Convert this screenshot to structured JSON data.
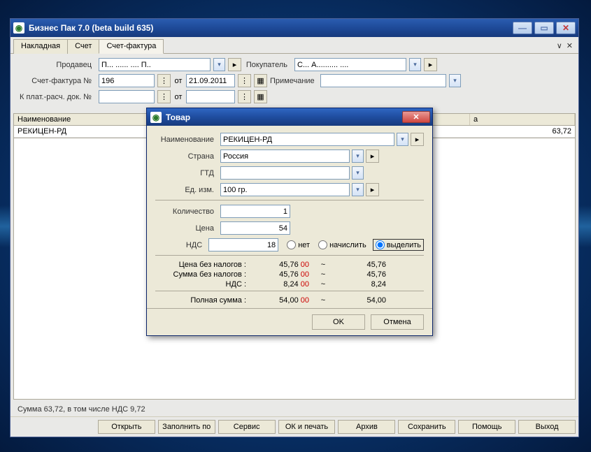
{
  "window": {
    "title": "Бизнес Пак 7.0 (beta build 635)"
  },
  "tabs": [
    "Накладная",
    "Счет",
    "Счет-фактура"
  ],
  "tab_tools": {
    "collapse": "∨",
    "close": "✕"
  },
  "form": {
    "seller_label": "Продавец",
    "seller_value": "П... ...... .... П..",
    "buyer_label": "Покупатель",
    "buyer_value": "С... А.......... ....",
    "invoice_no_label": "Счет-фактура №",
    "invoice_no": "196",
    "from_label": "от",
    "invoice_date": "21.09.2011",
    "note_label": "Примечание",
    "note_value": "",
    "payment_doc_label": "К плат.-расч. док. №"
  },
  "table": {
    "col_name": "Наименование",
    "col_sum": "а",
    "row_name": "РЕКИЦЕН-РД",
    "row_sum": "63,72"
  },
  "status": "Сумма 63,72, в том числе НДС 9,72",
  "buttons": {
    "open": "Открыть",
    "fill_by": "Заполнить по",
    "service": "Сервис",
    "ok_print": "ОК и печать",
    "archive": "Архив",
    "save": "Сохранить",
    "help": "Помощь",
    "exit": "Выход"
  },
  "dialog": {
    "title": "Товар",
    "name_label": "Наименование",
    "name_value": "РЕКИЦЕН-РД",
    "country_label": "Страна",
    "country_value": "Россия",
    "gtd_label": "ГТД",
    "gtd_value": "",
    "unit_label": "Ед. изм.",
    "unit_value": "100 гр.",
    "qty_label": "Количество",
    "qty_value": "1",
    "price_label": "Цена",
    "price_value": "54",
    "vat_label": "НДС",
    "vat_value": "18",
    "vat_none": "нет",
    "vat_add": "начислить",
    "vat_extract": "выделить",
    "calc": {
      "price_wo_tax_label": "Цена без налогов :",
      "price_wo_tax_main": "45,76",
      "price_wo_tax_frac": "00",
      "price_wo_tax_right": "45,76",
      "sum_wo_tax_label": "Сумма без налогов :",
      "sum_wo_tax_main": "45,76",
      "sum_wo_tax_frac": "00",
      "sum_wo_tax_right": "45,76",
      "vat_row_label": "НДС :",
      "vat_row_main": "8,24",
      "vat_row_frac": "00",
      "vat_row_right": "8,24",
      "total_label": "Полная сумма :",
      "total_main": "54,00",
      "total_frac": "00",
      "total_right": "54,00",
      "tilde": "~"
    },
    "ok": "OK",
    "cancel": "Отмена"
  }
}
